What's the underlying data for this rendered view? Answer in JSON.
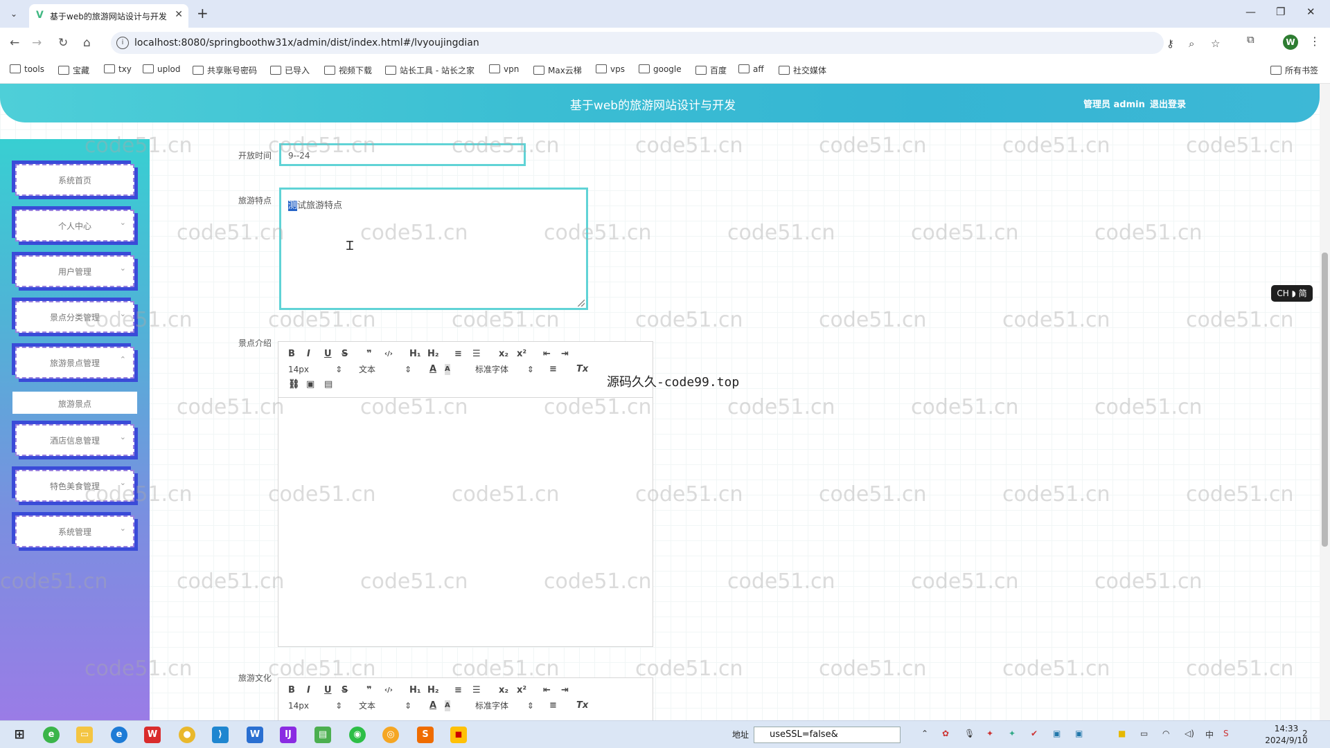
{
  "browser": {
    "tab_title": "基于web的旅游网站设计与开发",
    "url": "localhost:8080/springboothw31x/admin/dist/index.html#/lvyoujingdian",
    "profile_initial": "W",
    "bookmarks": [
      "tools",
      "宝藏",
      "txy",
      "uplod",
      "共享账号密码",
      "已导入",
      "视频下载",
      "站长工具 - 站长之家",
      "vpn",
      "Max云梯",
      "vps",
      "google",
      "百度",
      "aff",
      "社交媒体"
    ],
    "all_bookmarks": "所有书签"
  },
  "header": {
    "title": "基于web的旅游网站设计与开发",
    "user": "管理员 admin",
    "logout": "退出登录"
  },
  "sidebar": {
    "items": [
      "系统首页",
      "个人中心",
      "用户管理",
      "景点分类管理",
      "旅游景点管理",
      "酒店信息管理",
      "特色美食管理",
      "系统管理"
    ],
    "sub_item": "旅游景点"
  },
  "form": {
    "open_time_label": "开放时间",
    "open_time_value": "9--24",
    "feature_label": "旅游特点",
    "feature_selected": "测",
    "feature_rest": "试旅游特点",
    "intro_label": "景点介绍",
    "culture_label": "旅游文化"
  },
  "editor_toolbar": {
    "font_size": "14px",
    "text_type": "文本",
    "font_family": "标准字体",
    "buttons": [
      "B",
      "I",
      "U",
      "S",
      "❞",
      "‹/›",
      "H₁",
      "H₂",
      "≡",
      "☰",
      "x₂",
      "x²",
      "⇤",
      "⇥",
      "A",
      "A",
      "≡",
      "Tx"
    ]
  },
  "overlay": {
    "watermark": "code51.cn",
    "code99": "源码久久-code99.top",
    "ime": "CH ◗ 简"
  },
  "taskbar": {
    "address_label": "地址",
    "address_value": "useSSL=false&",
    "time": "14:33",
    "date": "2024/9/10",
    "ime_lang": "中",
    "notif_count": "2"
  },
  "colors": {
    "header": "#3bbed3",
    "sidebar_top": "#38cfd2",
    "sidebar_bottom": "#9a7ce6",
    "input_border": "#60d3d6",
    "menu_shadow": "#3a4bd8"
  }
}
